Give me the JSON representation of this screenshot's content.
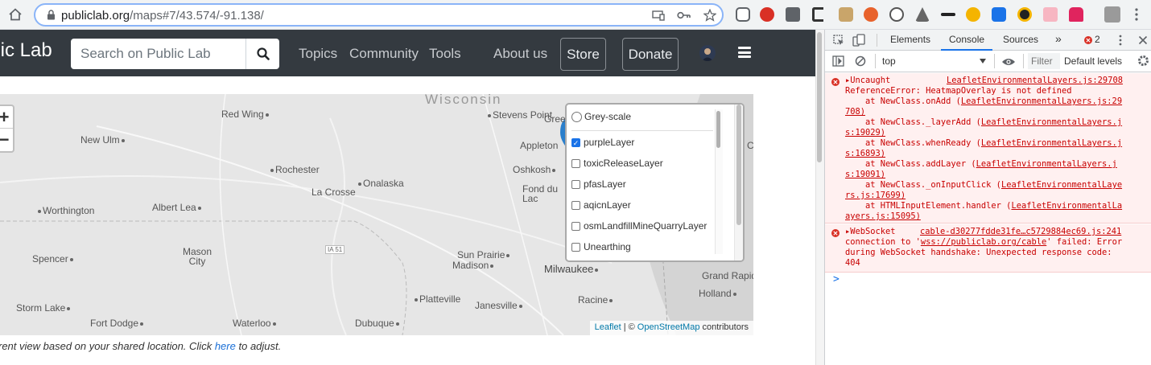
{
  "browser": {
    "url_host": "publiclab.org",
    "url_path": "/maps#7/43.574/-91.138/"
  },
  "navbar": {
    "logo": "blic Lab",
    "search_placeholder": "Search on Public Lab",
    "links": [
      "Topics",
      "Community",
      "Tools",
      "About us"
    ],
    "store": "Store",
    "donate": "Donate"
  },
  "map": {
    "zoom_in": "+",
    "zoom_out": "−",
    "state_label": "Wisconsin",
    "highway": "IA 51",
    "cities": [
      "Red Wing",
      "Stevens Point",
      "Green Bay",
      "New Ulm",
      "Appleton",
      "Rochester",
      "Oshkosh",
      "La Crosse",
      "Onalaska",
      "Fond du Lac",
      "Worthington",
      "Albert Lea",
      "Mason City",
      "Sun Prairie",
      "Madison",
      "Milwaukee",
      "Spencer",
      "Grand Rapids",
      "Holland",
      "Platteville",
      "Janesville",
      "Racine",
      "Storm Lake",
      "Fort Dodge",
      "Waterloo",
      "Dubuque",
      "Chicago"
    ],
    "layer_panel": {
      "base_layer": "Grey-scale",
      "overlays": [
        {
          "label": "purpleLayer",
          "checked": true
        },
        {
          "label": "toxicReleaseLayer",
          "checked": false
        },
        {
          "label": "pfasLayer",
          "checked": false
        },
        {
          "label": "aqicnLayer",
          "checked": false
        },
        {
          "label": "osmLandfillMineQuarryLayer",
          "checked": false
        },
        {
          "label": "Unearthing",
          "checked": false
        }
      ]
    },
    "attribution": {
      "leaflet": "Leaflet",
      "separator": "| ©",
      "osm": "OpenStreetMap",
      "suffix": "contributors"
    }
  },
  "location_note": {
    "prefix": "rent view based on your shared location. Click",
    "link": "here",
    "suffix": "to adjust."
  },
  "devtools": {
    "tabs": [
      "Elements",
      "Console",
      "Sources"
    ],
    "more": "»",
    "error_count": "2",
    "context": "top",
    "filter_placeholder": "Filter",
    "levels": "Default levels",
    "messages": [
      {
        "lines": [
          "▸Uncaught",
          "ReferenceError: HeatmapOverlay is not defined",
          "    at NewClass.onAdd (",
          "708)",
          "    at NewClass._layerAdd (",
          "s:19029)",
          "    at NewClass.whenReady (",
          "s:16893)",
          "    at NewClass.addLayer (",
          "s:19091)",
          "    at NewClass._onInputClick (",
          "rs.js:17699)",
          "    at HTMLInputElement.handler (",
          "ayers.js:15095)"
        ],
        "source": "LeafletEnvironmentalLayers.js:29708",
        "links": [
          "LeafletEnvironmentalLayers.js:29",
          "LeafletEnvironmentalLayers.j",
          "LeafletEnvironmentalLayers.j",
          "LeafletEnvironmentalLayers.j",
          "LeafletEnvironmentalLaye",
          "LeafletEnvironmentalLa"
        ]
      },
      {
        "lines": [
          "▸WebSocket",
          "connection to '",
          "' failed: Error",
          "during WebSocket handshake: Unexpected response code:",
          "404"
        ],
        "source": "cable-d30277fdde31fe…c5729884ec69.js:241",
        "url": "wss://publiclab.org/cable"
      }
    ],
    "prompt": ">"
  }
}
